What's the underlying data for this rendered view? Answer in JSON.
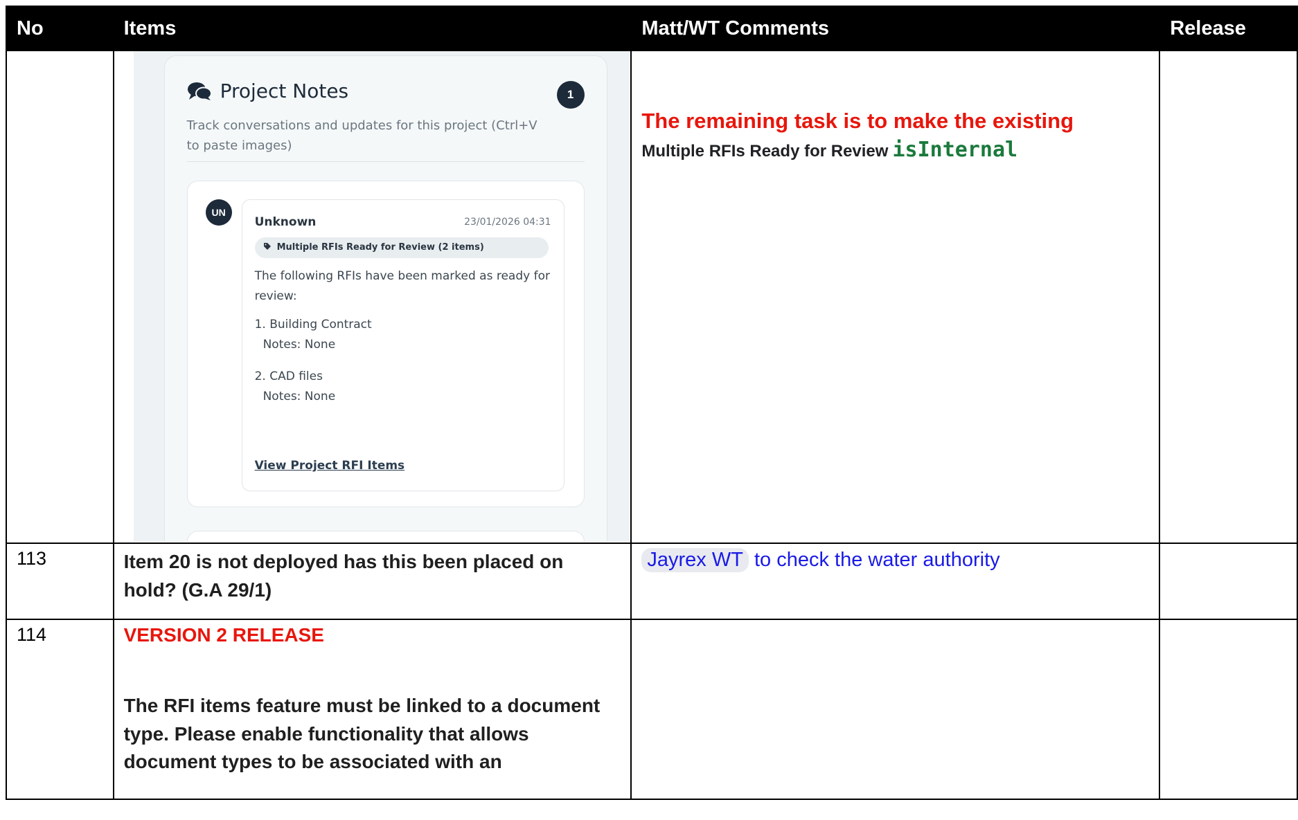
{
  "headers": {
    "no": "No",
    "items": "Items",
    "comments": "Matt/WT Comments",
    "release": "Release"
  },
  "row1": {
    "screenshot": {
      "title": "Project Notes",
      "badge_count": "1",
      "subtitle": "Track conversations and updates for this project (Ctrl+V to paste images)",
      "note": {
        "avatar": "UN",
        "author": "Unknown",
        "date": "23/01/2026 04:31",
        "tag": "Multiple RFIs Ready for Review (2 items)",
        "body_intro": "The following RFIs have been marked as ready for review:",
        "item1": "1. Building Contract",
        "item1_notes": "Notes: None",
        "item2": "2. CAD files",
        "item2_notes": "Notes: None",
        "link": "View Project RFI Items"
      }
    },
    "comment_red": "The remaining task is to make the existing",
    "comment_bold": "Multiple RFIs Ready for Review",
    "comment_code": "isInternal"
  },
  "row2": {
    "no": "113",
    "item": "Item 20 is not deployed has this been placed on hold? (G.A 29/1)",
    "comment_chip": "Jayrex WT",
    "comment_text": " to check the water authority"
  },
  "row3": {
    "no": "114",
    "item_heading": "VERSION 2 RELEASE",
    "item_body": "The RFI items feature must be linked to a document type. Please enable functionality that allows document types to be associated with an"
  }
}
